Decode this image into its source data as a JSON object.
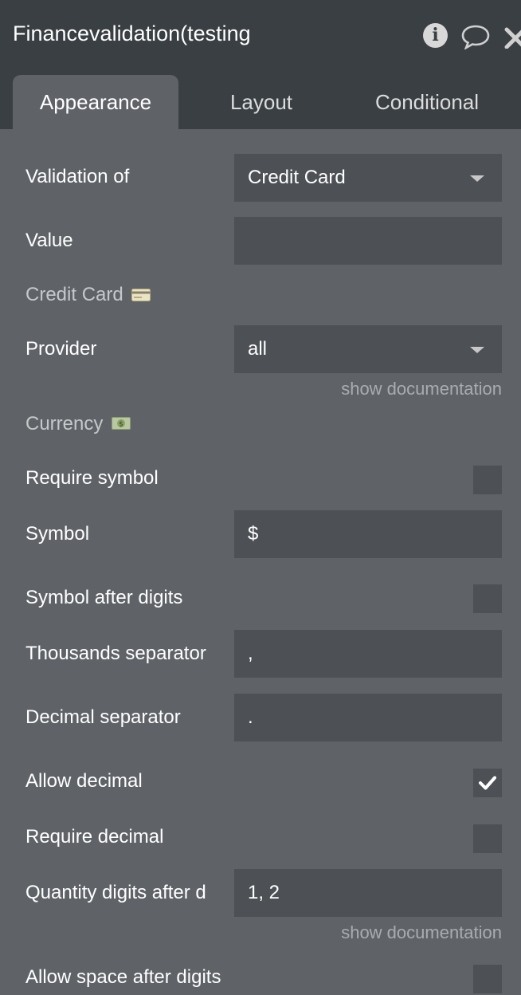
{
  "window": {
    "title": "Financevalidation(testing",
    "icons": [
      "info-icon",
      "comment-icon",
      "close-icon"
    ]
  },
  "tabs": [
    {
      "label": "Appearance",
      "active": true
    },
    {
      "label": "Layout",
      "active": false
    },
    {
      "label": "Conditional",
      "active": false
    }
  ],
  "form": {
    "validation_of": {
      "label": "Validation of",
      "value": "Credit Card"
    },
    "value": {
      "label": "Value",
      "value": ""
    },
    "credit_card_section": {
      "label": "Credit Card",
      "icon": "credit-card-icon"
    },
    "provider": {
      "label": "Provider",
      "value": "all",
      "doc_link": "show documentation"
    },
    "currency_section": {
      "label": "Currency",
      "icon": "money-icon"
    },
    "require_symbol": {
      "label": "Require symbol",
      "checked": false
    },
    "symbol": {
      "label": "Symbol",
      "value": "$"
    },
    "symbol_after_digits": {
      "label": "Symbol after digits",
      "checked": false
    },
    "thousands_separator": {
      "label": "Thousands separator",
      "value": ","
    },
    "decimal_separator": {
      "label": "Decimal separator",
      "value": "."
    },
    "allow_decimal": {
      "label": "Allow decimal",
      "checked": true
    },
    "require_decimal": {
      "label": "Require decimal",
      "checked": false
    },
    "quantity_digits": {
      "label": "Quantity digits after d",
      "value": "1, 2",
      "doc_link": "show documentation"
    },
    "allow_space_after_digits": {
      "label": "Allow space after digits",
      "checked": false
    }
  },
  "colors": {
    "panel_bg": "#5f6368",
    "header_bg": "#3a3f43",
    "field_bg": "#4d5155",
    "muted_text": "#a9acaf"
  }
}
